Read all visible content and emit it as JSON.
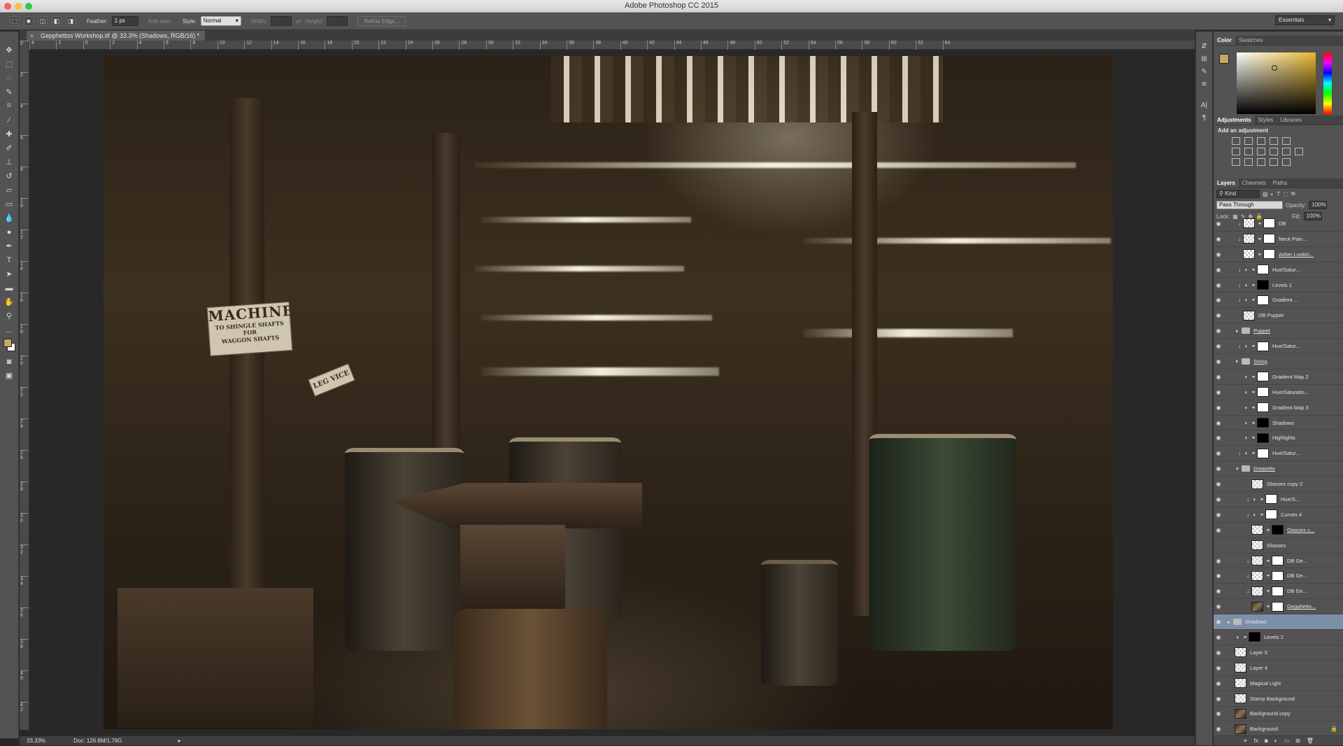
{
  "app": {
    "title": "Adobe Photoshop CC 2015",
    "light_colors": [
      "#fc605b",
      "#fdbc40",
      "#34c84a"
    ]
  },
  "options_bar": {
    "feather_label": "Feather:",
    "feather_value": "1 px",
    "antialias_label": "Anti-alias",
    "style_label": "Style:",
    "style_value": "Normal",
    "width_label": "Width:",
    "height_label": "Height:",
    "refine_edge": "Refine Edge...",
    "workspace": "Essentials"
  },
  "document": {
    "tab_title": "Gepphettos Workshop.tif @ 33.3% (Shadows, RGB/16) *",
    "ruler_h_ticks": [
      "4",
      "2",
      "0",
      "2",
      "4",
      "6",
      "8",
      "10",
      "12",
      "14",
      "16",
      "18",
      "20",
      "22",
      "24",
      "26",
      "28",
      "30",
      "32",
      "34",
      "36",
      "38",
      "40",
      "42",
      "44",
      "46",
      "48",
      "50",
      "52",
      "54",
      "56",
      "58",
      "60",
      "62",
      "64"
    ],
    "ruler_v_ticks": [
      "0",
      "2",
      "4",
      "6",
      "8",
      "1\n0",
      "1\n2",
      "1\n4",
      "1\n6",
      "1\n8",
      "2\n0",
      "2\n2",
      "2\n4",
      "2\n6",
      "2\n8",
      "3\n0",
      "3\n2",
      "3\n4",
      "3\n6",
      "3\n8",
      "4\n0",
      "4\n2"
    ],
    "sign1_line1": "MACHINE",
    "sign1_line2": "TO SHINGLE SHAFTS FOR",
    "sign1_line3": "WAGGON SHAFTS",
    "sign2": "LEG VICE"
  },
  "status": {
    "zoom": "33.33%",
    "doc_size": "Doc: 126.8M/1.76G"
  },
  "panels": {
    "color_tabs": [
      "Color",
      "Swatches"
    ],
    "adjust_tabs": [
      "Adjustments",
      "Styles",
      "Libraries"
    ],
    "adjust_title": "Add an adjustment",
    "layer_tabs": [
      "Layers",
      "Channels",
      "Paths"
    ],
    "kind_label": "Kind",
    "blend_mode": "Pass Through",
    "opacity_label": "Opacity:",
    "opacity_value": "100%",
    "lock_label": "Lock:",
    "fill_label": "Fill:",
    "fill_value": "100%",
    "foreground_color": "#c8a665"
  },
  "layers": [
    {
      "name": "DB",
      "thumb": "checker",
      "mask": "white",
      "indent": 1,
      "clip": true
    },
    {
      "name": "Neck Pain...",
      "thumb": "checker",
      "mask": "white",
      "indent": 1,
      "clip": true
    },
    {
      "name": "Asher Lookin...",
      "thumb": "checker",
      "mask": "white",
      "indent": 1,
      "underline": true
    },
    {
      "name": "Hue/Satur...",
      "thumb": "white",
      "adj": true,
      "indent": 1,
      "clip": true
    },
    {
      "name": "Levels 1",
      "thumb": "black",
      "adj": true,
      "indent": 1,
      "clip": true
    },
    {
      "name": "Gradient ...",
      "thumb": "white",
      "adj": true,
      "indent": 1,
      "clip": true
    },
    {
      "name": "DB Puppet",
      "thumb": "checker",
      "indent": 1
    },
    {
      "name": "Puppet",
      "folder": true,
      "indent": 1,
      "underline": true
    },
    {
      "name": "Hue/Satur...",
      "thumb": "white",
      "adj": true,
      "indent": 1,
      "clip": true
    },
    {
      "name": "String",
      "folder": true,
      "indent": 1,
      "underline": true
    },
    {
      "name": "Gradient Map 2",
      "thumb": "white",
      "adj": true,
      "indent": 1
    },
    {
      "name": "Hue/Saturatio...",
      "thumb": "white",
      "adj": true,
      "indent": 1
    },
    {
      "name": "Gradient Map 3",
      "thumb": "white",
      "adj": true,
      "indent": 1
    },
    {
      "name": "Shadows",
      "thumb": "black",
      "adj": true,
      "indent": 1
    },
    {
      "name": "Highlights",
      "thumb": "black",
      "adj": true,
      "indent": 1
    },
    {
      "name": "Hue/Satur...",
      "thumb": "white",
      "adj": true,
      "indent": 1,
      "clip": true
    },
    {
      "name": "Geppetto",
      "folder": true,
      "open": true,
      "indent": 1,
      "underline": true
    },
    {
      "name": "Glasses copy 2",
      "thumb": "checker",
      "indent": 2
    },
    {
      "name": "Hue/S...",
      "thumb": "white",
      "adj": true,
      "indent": 2,
      "clip": true
    },
    {
      "name": "Curves 4",
      "thumb": "white",
      "adj": true,
      "indent": 2,
      "clip": true
    },
    {
      "name": "Glasses c...",
      "thumb": "checker",
      "mask": "black",
      "indent": 2,
      "underline": true
    },
    {
      "name": "Glasses",
      "thumb": "checker",
      "indent": 2,
      "hidden": true
    },
    {
      "name": "DB Ge...",
      "thumb": "checker",
      "mask": "white",
      "indent": 2,
      "clip": true
    },
    {
      "name": "DB Ge...",
      "thumb": "checker",
      "mask": "white",
      "indent": 2,
      "clip": true
    },
    {
      "name": "DB Ge...",
      "thumb": "checker",
      "mask": "white",
      "indent": 2,
      "clip": true
    },
    {
      "name": "Gepphetto...",
      "thumb": "photo",
      "mask": "white",
      "indent": 2,
      "underline": true
    },
    {
      "name": "Shadows",
      "folder": true,
      "indent": 0,
      "selected": true
    },
    {
      "name": "Levels 2",
      "thumb": "black",
      "adj": true,
      "indent": 0
    },
    {
      "name": "Layer 5",
      "thumb": "checker",
      "indent": 0
    },
    {
      "name": "Layer 4",
      "thumb": "checker",
      "indent": 0
    },
    {
      "name": "Magical Light",
      "thumb": "checker",
      "indent": 0
    },
    {
      "name": "Stamp Background",
      "thumb": "checker",
      "indent": 0
    },
    {
      "name": "Background copy",
      "thumb": "photo",
      "indent": 0
    },
    {
      "name": "Background",
      "thumb": "photo",
      "indent": 0,
      "locked": true
    }
  ]
}
